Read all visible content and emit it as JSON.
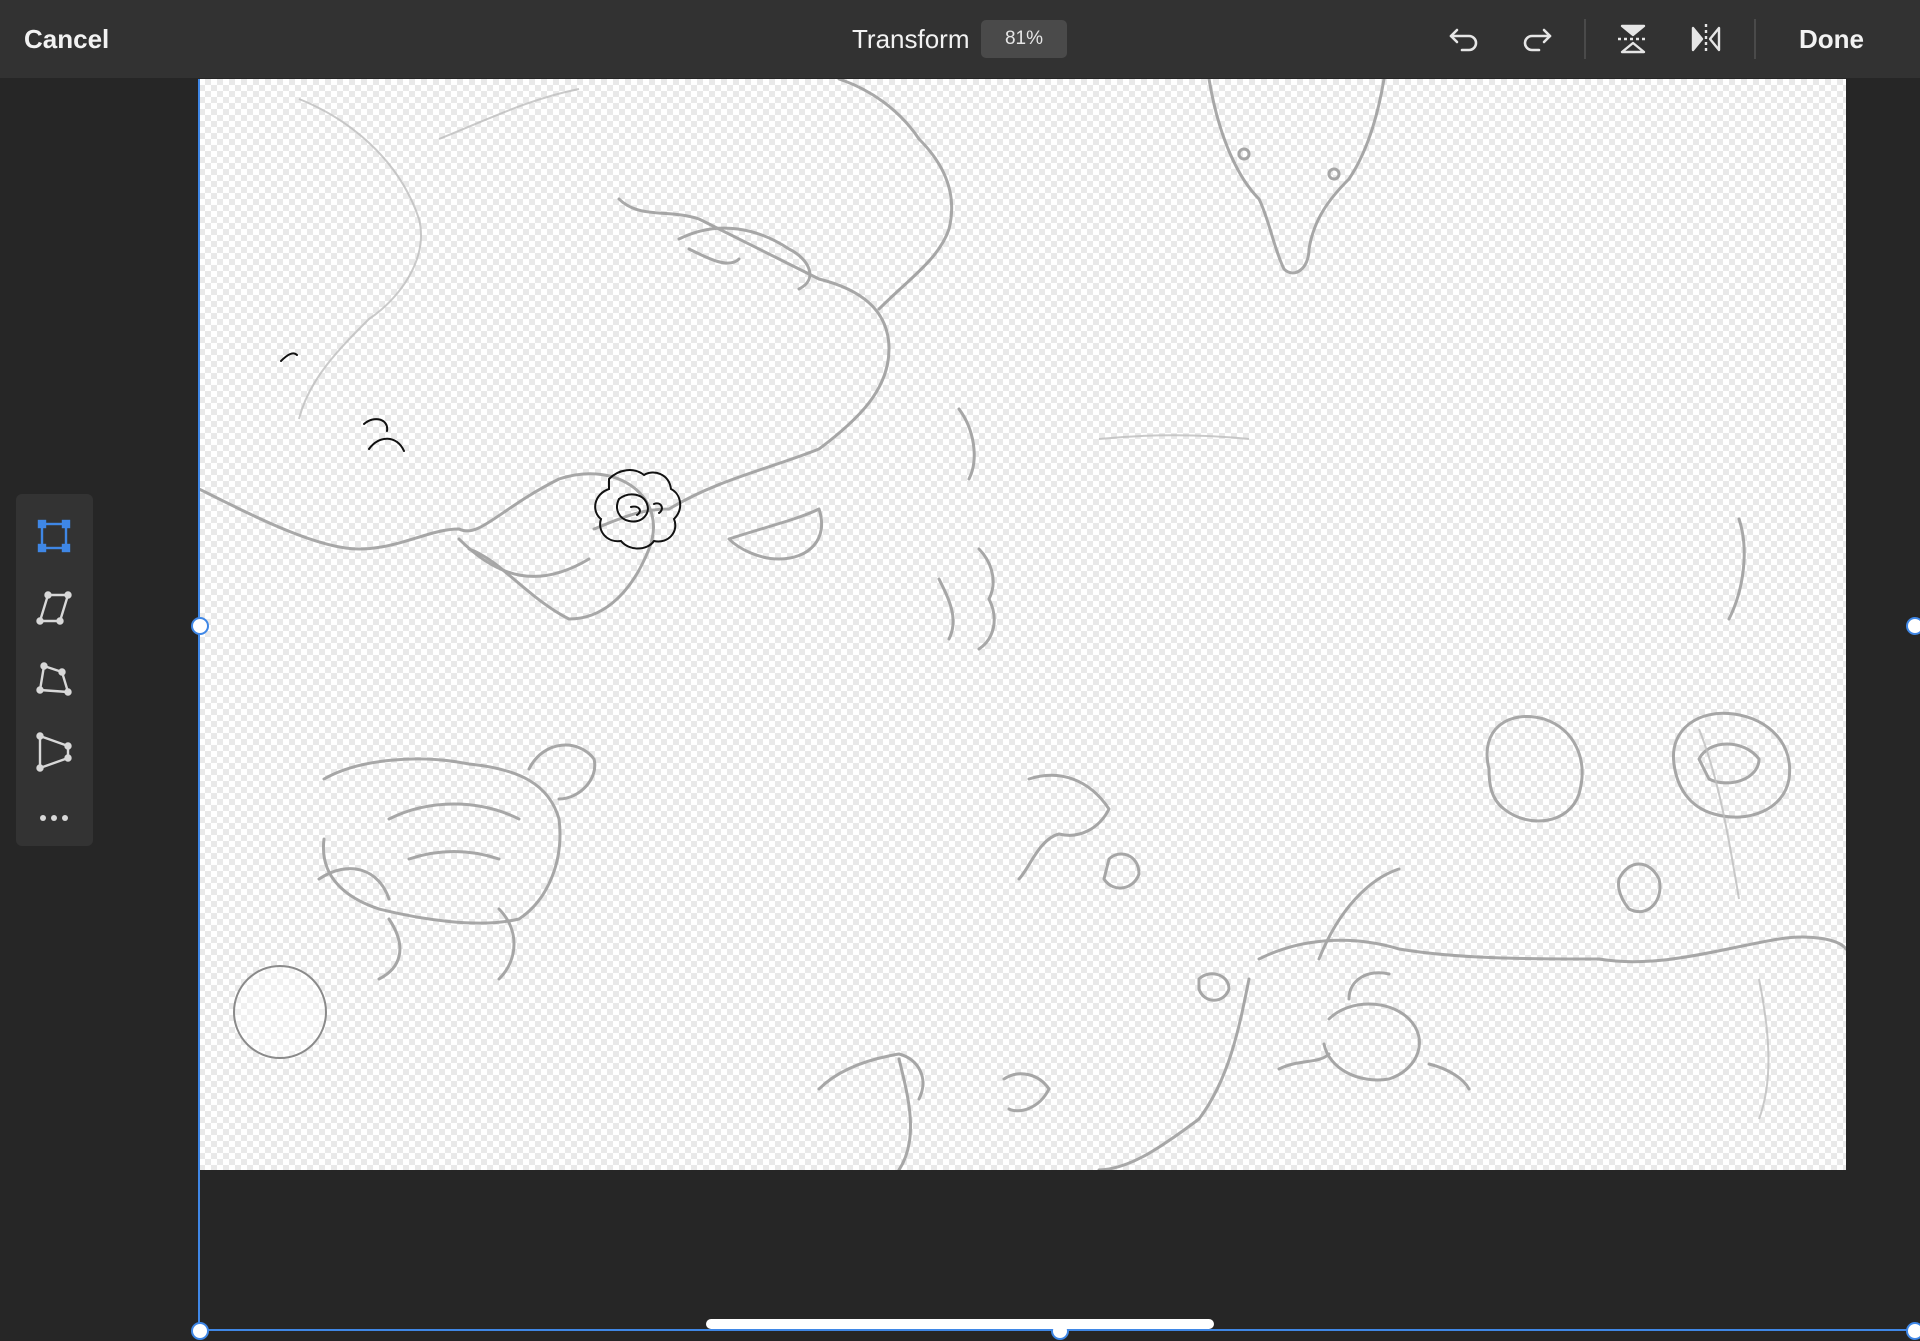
{
  "topbar": {
    "cancel_label": "Cancel",
    "title": "Transform",
    "zoom_level": "81%",
    "done_label": "Done",
    "icons": [
      "undo-icon",
      "redo-icon",
      "flip-vertical-icon",
      "flip-horizontal-icon"
    ]
  },
  "tools": [
    {
      "name": "free-transform-icon",
      "active": true
    },
    {
      "name": "skew-icon",
      "active": false
    },
    {
      "name": "distort-icon",
      "active": false
    },
    {
      "name": "perspective-icon",
      "active": false
    },
    {
      "name": "more-icon",
      "active": false
    }
  ],
  "colors": {
    "accent": "#3f87e6",
    "topbar_bg": "#323232",
    "app_bg": "#262626",
    "panel_bg": "#333333"
  }
}
